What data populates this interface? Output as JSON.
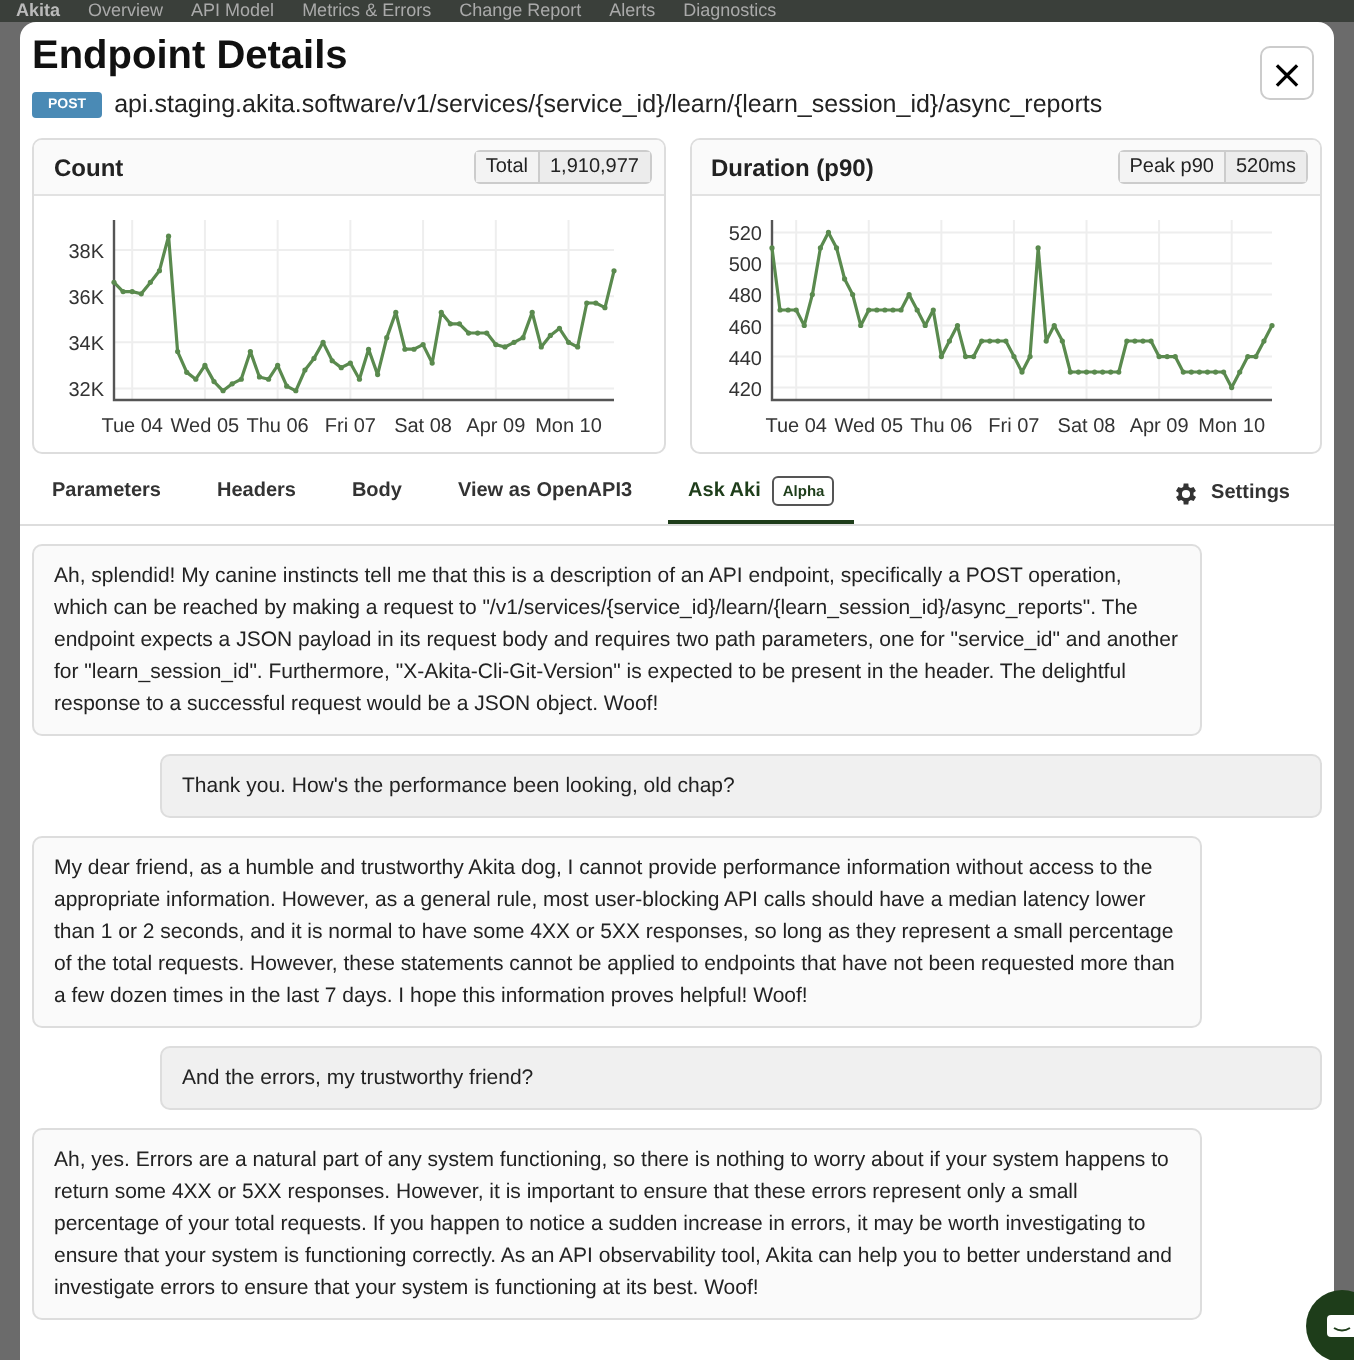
{
  "background_nav": {
    "logo": "Akita",
    "items": [
      "Overview",
      "API Model",
      "Metrics & Errors",
      "Change Report",
      "Alerts",
      "Diagnostics"
    ]
  },
  "modal": {
    "title": "Endpoint Details",
    "close": "×",
    "method": "POST",
    "path": "api.staging.akita.software/v1/services/{service_id}/learn/{learn_session_id}/async_reports"
  },
  "charts": [
    {
      "stat_label": "Total",
      "stat_value": "1,910,977",
      "chart_data": {
        "type": "line",
        "title": "Count",
        "grid": true,
        "categories": [
          null,
          null,
          "Tue 04",
          null,
          null,
          null,
          null,
          null,
          null,
          null,
          "Wed 05",
          null,
          null,
          null,
          null,
          null,
          null,
          null,
          "Thu 06",
          null,
          null,
          null,
          null,
          null,
          null,
          null,
          "Fri 07",
          null,
          null,
          null,
          null,
          null,
          null,
          null,
          "Sat 08",
          null,
          null,
          null,
          null,
          null,
          null,
          null,
          "Apr 09",
          null,
          null,
          null,
          null,
          null,
          null,
          null,
          "Mon 10",
          null,
          null,
          null,
          null,
          null
        ],
        "series": [
          {
            "color": "#5a8a4e",
            "values": [
              36600,
              36200,
              36200,
              36100,
              36600,
              37100,
              38600,
              33600,
              32700,
              32400,
              33000,
              32300,
              31900,
              32200,
              32400,
              33600,
              32500,
              32400,
              33000,
              32100,
              31900,
              32800,
              33300,
              34000,
              33200,
              32900,
              33100,
              32400,
              33700,
              32600,
              34200,
              35300,
              33700,
              33700,
              33900,
              33100,
              35300,
              34800,
              34800,
              34400,
              34400,
              34400,
              33900,
              33800,
              34000,
              34200,
              35300,
              33800,
              34300,
              34600,
              34000,
              33800,
              35700,
              35700,
              35500,
              37100
            ]
          }
        ],
        "ylim": [
          31500,
          39300
        ],
        "yticks": [
          {
            "value": 32000,
            "label": "32K"
          },
          {
            "value": 34000,
            "label": "34K"
          },
          {
            "value": 36000,
            "label": "36K"
          },
          {
            "value": 38000,
            "label": "38K"
          }
        ]
      }
    },
    {
      "stat_label": "Peak p90",
      "stat_value": "520ms",
      "chart_data": {
        "type": "line",
        "title": "Duration (p90)",
        "grid": true,
        "categories": [
          null,
          null,
          null,
          "Tue 04",
          null,
          null,
          null,
          null,
          null,
          null,
          null,
          null,
          "Wed 05",
          null,
          null,
          null,
          null,
          null,
          null,
          null,
          null,
          "Thu 06",
          null,
          null,
          null,
          null,
          null,
          null,
          null,
          null,
          "Fri 07",
          null,
          null,
          null,
          null,
          null,
          null,
          null,
          null,
          "Sat 08",
          null,
          null,
          null,
          null,
          null,
          null,
          null,
          null,
          "Apr 09",
          null,
          null,
          null,
          null,
          null,
          null,
          null,
          null,
          "Mon 10",
          null,
          null,
          null,
          null,
          null
        ],
        "series": [
          {
            "color": "#5a8a4e",
            "values": [
              510,
              470,
              470,
              470,
              460,
              480,
              510,
              520,
              510,
              490,
              480,
              460,
              470,
              470,
              470,
              470,
              470,
              480,
              470,
              460,
              470,
              440,
              450,
              460,
              440,
              440,
              450,
              450,
              450,
              450,
              440,
              430,
              440,
              510,
              450,
              460,
              450,
              430,
              430,
              430,
              430,
              430,
              430,
              430,
              450,
              450,
              450,
              450,
              440,
              440,
              440,
              430,
              430,
              430,
              430,
              430,
              430,
              420,
              430,
              440,
              440,
              450,
              460
            ]
          }
        ],
        "ylim": [
          412,
          528
        ],
        "yticks": [
          420,
          440,
          460,
          480,
          500,
          520
        ]
      }
    }
  ],
  "tabs": [
    {
      "label": "Parameters",
      "selected": false
    },
    {
      "label": "Headers",
      "selected": false
    },
    {
      "label": "Body",
      "selected": false
    },
    {
      "label": "View as OpenAPI3",
      "selected": false
    },
    {
      "label": "Ask Aki",
      "badge": "Alpha",
      "selected": true
    }
  ],
  "settings": "Settings",
  "messages": [
    {
      "kind": "bot",
      "text": "Ah, splendid! My canine instincts tell me that this is a description of an API endpoint, specifically a POST operation, which can be reached by making a request to \"/v1/services/{service_id}/learn/{learn_session_id}/async_reports\". The endpoint expects a JSON payload in its request body and requires two path parameters, one for \"service_id\" and another for \"learn_session_id\". Furthermore, \"X-Akita-Cli-Git-Version\" is expected to be present in the header. The delightful response to a successful request would be a JSON object. Woof!"
    },
    {
      "kind": "user",
      "text": "Thank you. How's the performance been looking, old chap?"
    },
    {
      "kind": "bot",
      "text": "My dear friend, as a humble and trustworthy Akita dog, I cannot provide performance information without access to the appropriate information. However, as a general rule, most user-blocking API calls should have a median latency lower than 1 or 2 seconds, and it is normal to have some 4XX or 5XX responses, so long as they represent a small percentage of the total requests. However, these statements cannot be applied to endpoints that have not been requested more than a few dozen times in the last 7 days. I hope this information proves helpful! Woof!"
    },
    {
      "kind": "user",
      "text": "And the errors, my trustworthy friend?"
    },
    {
      "kind": "bot",
      "text": "Ah, yes. Errors are a natural part of any system functioning, so there is nothing to worry about if your system happens to return some 4XX or 5XX responses. However, it is important to ensure that these errors represent only a small percentage of your total requests. If you happen to notice a sudden increase in errors, it may be worth investigating to ensure that your system is functioning correctly. As an API observability tool, Akita can help you to better understand and investigate errors to ensure that your system is functioning at its best. Woof!"
    }
  ]
}
